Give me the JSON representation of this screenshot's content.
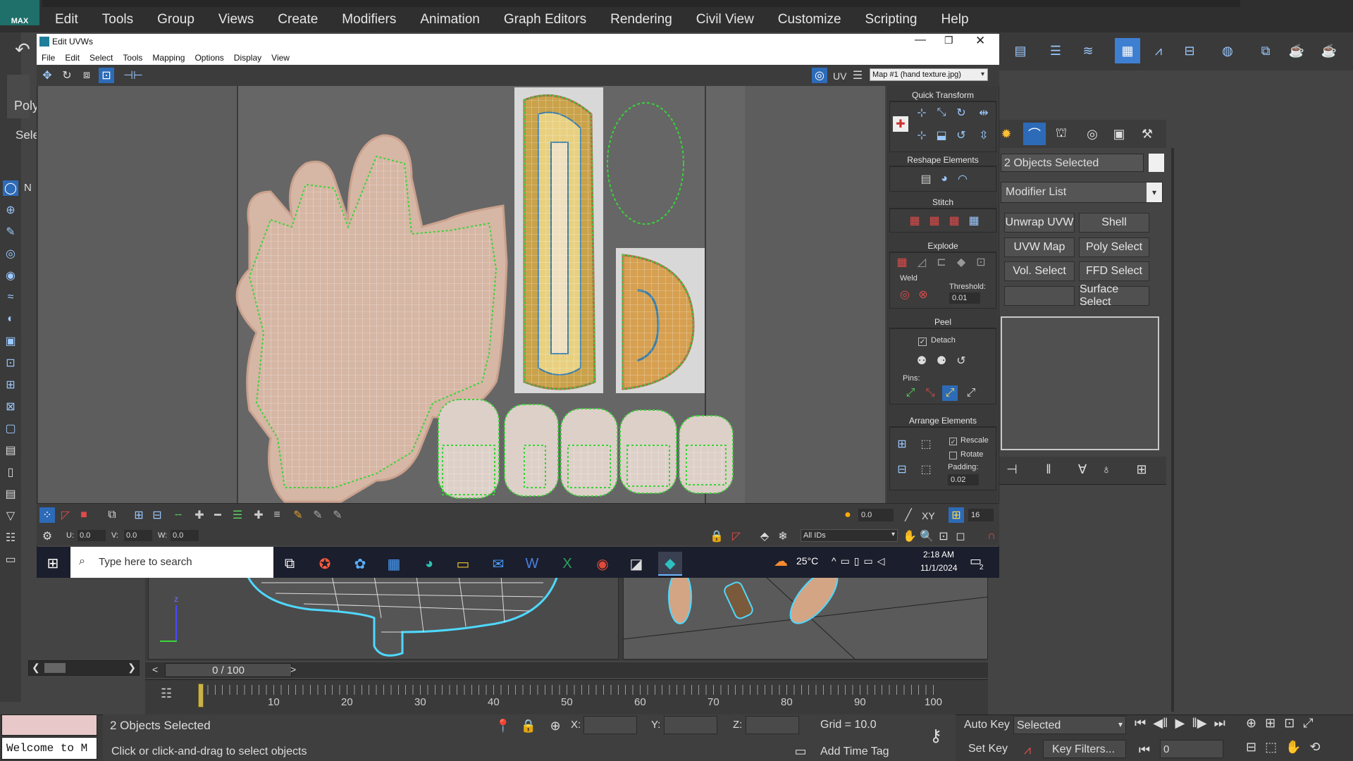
{
  "app": {
    "logo_text": "MAX",
    "menu": [
      "Edit",
      "Tools",
      "Group",
      "Views",
      "Create",
      "Modifiers",
      "Animation",
      "Graph Editors",
      "Rendering",
      "Civil View",
      "Customize",
      "Scripting",
      "Help"
    ]
  },
  "left_labels": {
    "poly": "Poly",
    "sele": "Sele",
    "n_tab": "N"
  },
  "uvw": {
    "title": "Edit UVWs",
    "menu": [
      "File",
      "Edit",
      "Select",
      "Tools",
      "Mapping",
      "Options",
      "Display",
      "View"
    ],
    "uv_label": "UV",
    "map_select": "Map #1 (hand texture.jpg)",
    "panels": {
      "quick_transform": "Quick Transform",
      "reshape": "Reshape Elements",
      "stitch": "Stitch",
      "explode": "Explode",
      "weld": "Weld",
      "threshold_label": "Threshold:",
      "threshold_value": "0.01",
      "peel": "Peel",
      "detach": "Detach",
      "pins": "Pins:",
      "arrange": "Arrange Elements",
      "rescale": "Rescale",
      "rotate": "Rotate",
      "padding_label": "Padding:",
      "padding_value": "0.02"
    },
    "bottom_toolbar": {
      "spinner_value": "0.0",
      "xy_label": "XY",
      "grid_value": "16",
      "u_label": "U:",
      "u_value": "0.0",
      "v_label": "V:",
      "v_value": "0.0",
      "w_label": "W:",
      "w_value": "0.0",
      "ids_select": "All IDs"
    }
  },
  "taskbar": {
    "search_placeholder": "Type here to search",
    "weather": "25°C",
    "time": "2:18 AM",
    "date": "11/1/2024",
    "notification_count": "2"
  },
  "command_panel": {
    "selection_name": "2 Objects Selected",
    "modifier_list": "Modifier List",
    "buttons": [
      "Unwrap UVW",
      "Shell",
      "UVW Map",
      "Poly Select",
      "Vol. Select",
      "FFD Select",
      "",
      "Surface Select"
    ]
  },
  "timeline": {
    "frame_display": "0 / 100",
    "ruler": [
      "10",
      "20",
      "30",
      "40",
      "50",
      "60",
      "70",
      "80",
      "90",
      "100"
    ]
  },
  "status": {
    "listener_text": "Welcome to M",
    "selection_text": "2 Objects Selected",
    "prompt_text": "Click or click-and-drag to select objects",
    "x_label": "X:",
    "y_label": "Y:",
    "z_label": "Z:",
    "grid_text": "Grid = 10.0",
    "add_time_tag": "Add Time Tag",
    "auto_key": "Auto Key",
    "set_key": "Set Key",
    "key_mode": "Selected",
    "key_filters": "Key Filters...",
    "frame_value": "0"
  }
}
